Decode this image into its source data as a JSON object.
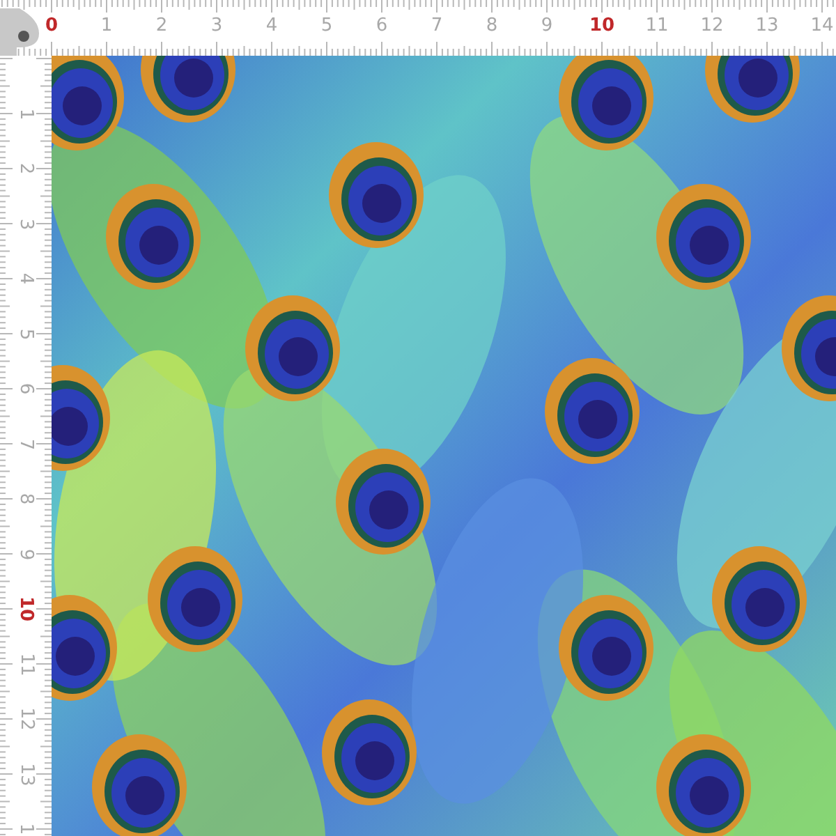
{
  "top_ruler": {
    "labels": [
      {
        "text": "0",
        "emphasized": true
      },
      {
        "text": "1",
        "emphasized": false
      },
      {
        "text": "2",
        "emphasized": false
      },
      {
        "text": "3",
        "emphasized": false
      },
      {
        "text": "4",
        "emphasized": false
      },
      {
        "text": "5",
        "emphasized": false
      },
      {
        "text": "6",
        "emphasized": false
      },
      {
        "text": "7",
        "emphasized": false
      },
      {
        "text": "8",
        "emphasized": false
      },
      {
        "text": "9",
        "emphasized": false
      },
      {
        "text": "10",
        "emphasized": true
      },
      {
        "text": "11",
        "emphasized": false
      },
      {
        "text": "12",
        "emphasized": false
      },
      {
        "text": "13",
        "emphasized": false
      },
      {
        "text": "14",
        "emphasized": false
      }
    ]
  },
  "left_ruler": {
    "labels": [
      {
        "text": "1",
        "emphasized": false
      },
      {
        "text": "2",
        "emphasized": false
      },
      {
        "text": "3",
        "emphasized": false
      },
      {
        "text": "4",
        "emphasized": false
      },
      {
        "text": "5",
        "emphasized": false
      },
      {
        "text": "6",
        "emphasized": false
      },
      {
        "text": "7",
        "emphasized": false
      },
      {
        "text": "8",
        "emphasized": false
      },
      {
        "text": "9",
        "emphasized": false
      },
      {
        "text": "10",
        "emphasized": true
      },
      {
        "text": "11",
        "emphasized": false
      },
      {
        "text": "12",
        "emphasized": false
      },
      {
        "text": "13",
        "emphasized": false
      },
      {
        "text": "1",
        "emphasized": false
      }
    ]
  }
}
